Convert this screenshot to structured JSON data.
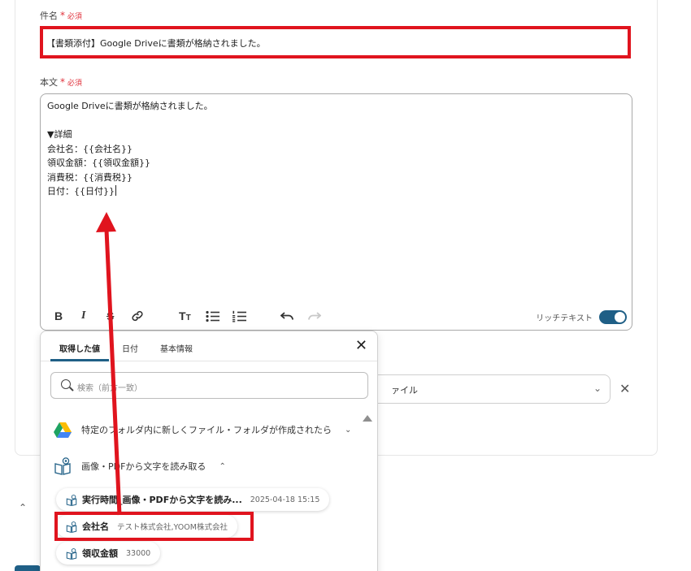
{
  "form": {
    "subject_label": "件名",
    "required_mark": "*",
    "required_text": "必須",
    "subject_value": "【書類添付】Google Driveに書類が格納されました。",
    "body_label": "本文",
    "body_lines": [
      "Google Driveに書類が格納されました。",
      "",
      "▼詳細",
      "会社名：{{会社名}}",
      "領収金額：{{領収金額}}",
      "消費税：{{消費税}}",
      "日付：{{日付}}"
    ],
    "rich_text_label": "リッチテキスト",
    "rich_text_enabled": true,
    "attachment_select_value": "ァイル"
  },
  "toolbar": {
    "bold": "B",
    "italic": "I",
    "strike": "S",
    "link_icon": "link-icon",
    "heading": "T",
    "bullet_icon": "bullet-list-icon",
    "ordered_icon": "ordered-list-icon",
    "undo_icon": "undo-icon",
    "redo_icon": "redo-icon"
  },
  "popup": {
    "tabs": [
      "取得した値",
      "日付",
      "基本情報"
    ],
    "active_tab": 0,
    "search_placeholder": "検索（前方一致）",
    "sections": [
      {
        "label": "特定のフォルダ内に新しくファイル・フォルダが作成されたら",
        "icon": "google-drive-icon",
        "expanded": false
      },
      {
        "label": "画像・PDFから文字を読み取る",
        "icon": "ocr-icon",
        "expanded": true
      }
    ],
    "items": [
      {
        "name": "実行時間_画像・PDFから文字を読み...",
        "value": "2025-04-18 15:15"
      },
      {
        "name": "会社名",
        "value": "テスト株式会社,YOOM株式会社"
      },
      {
        "name": "領収金額",
        "value": "33000"
      }
    ]
  },
  "colors": {
    "highlight": "#e0141e",
    "accent": "#1f5f86",
    "required": "#e0323c"
  }
}
